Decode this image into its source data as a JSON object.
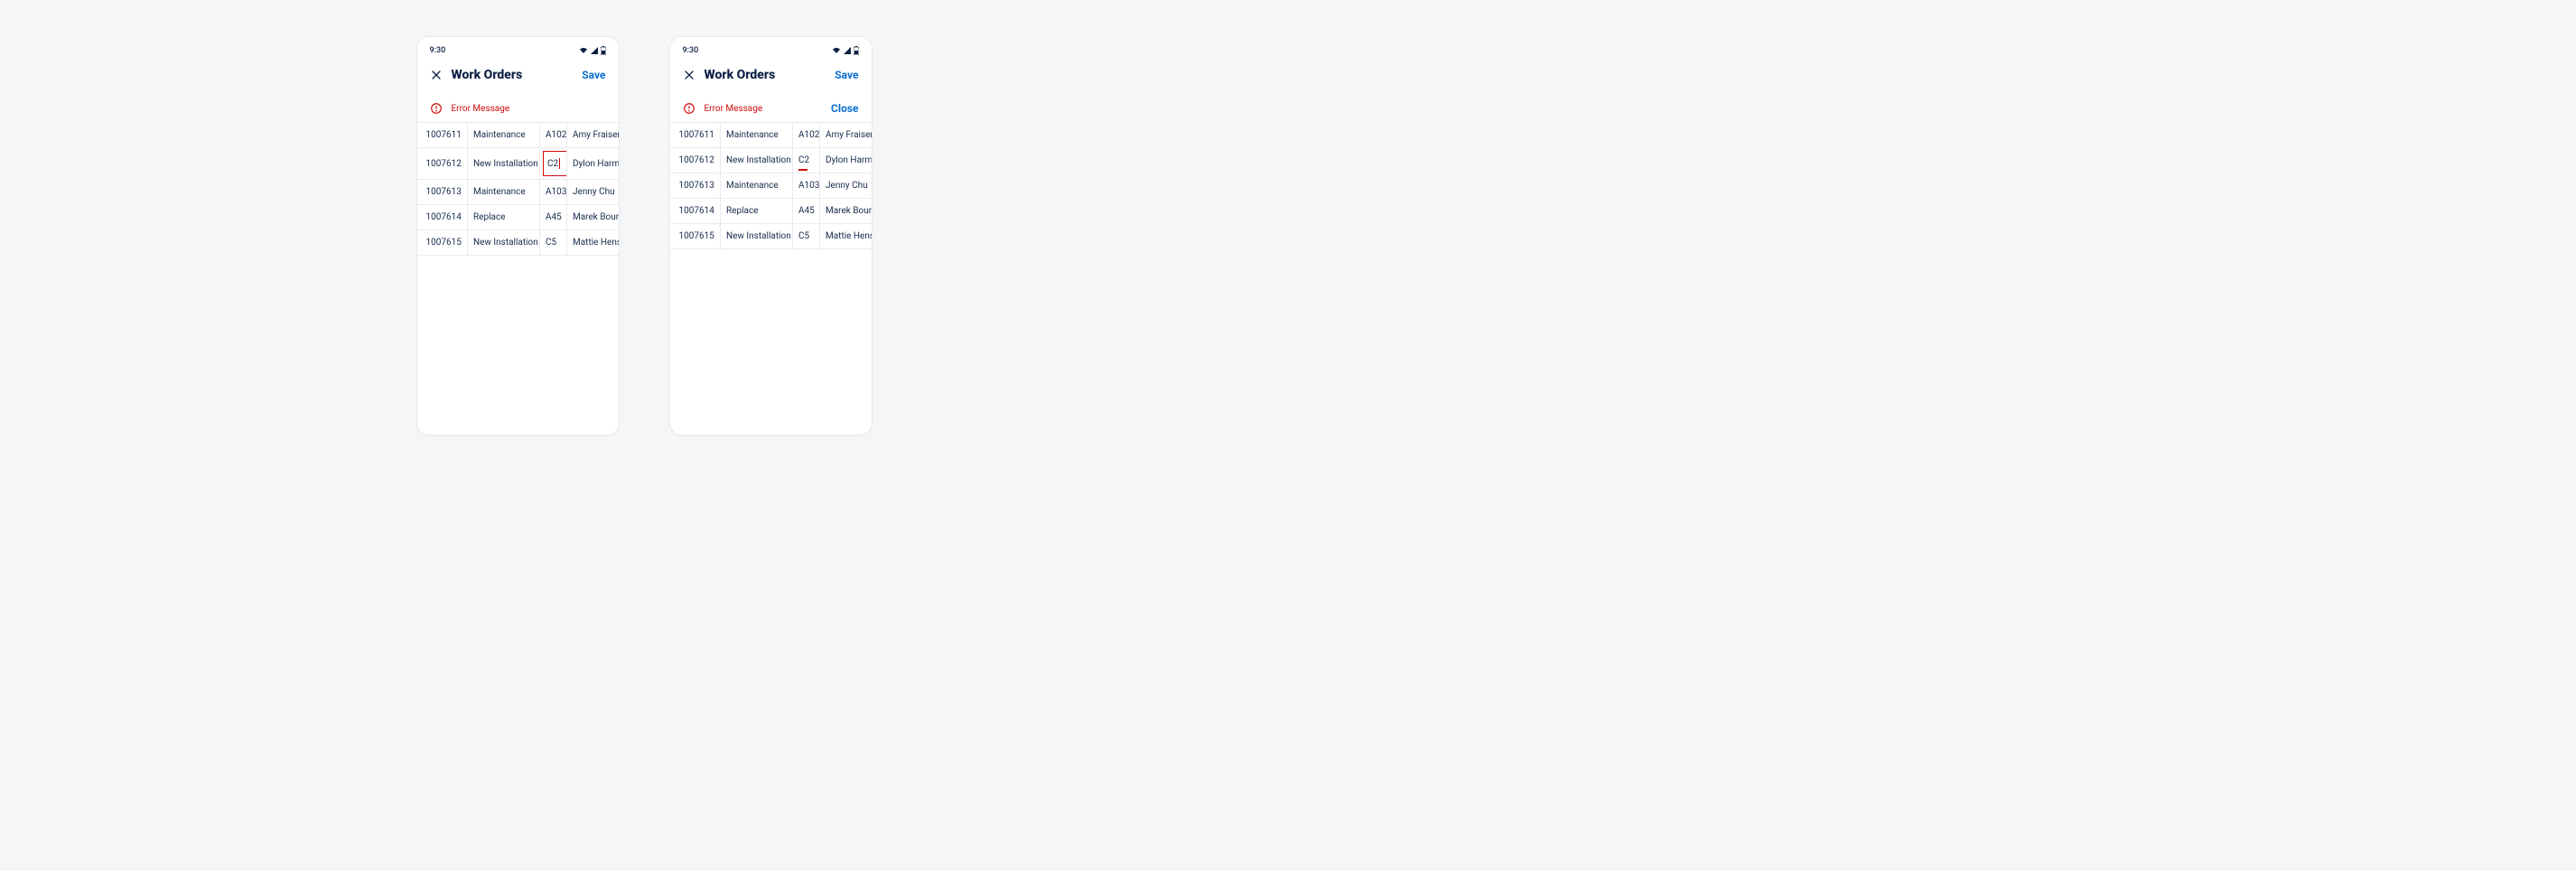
{
  "status": {
    "time": "9:30"
  },
  "header": {
    "title": "Work Orders",
    "save_label": "Save"
  },
  "error": {
    "message": "Error Message",
    "close_label": "Close"
  },
  "rows": [
    {
      "id": "1007611",
      "type": "Maintenance",
      "loc": "A102",
      "name": "Amy Fraiser"
    },
    {
      "id": "1007612",
      "type": "New Installation",
      "loc": "C2",
      "name": "Dylon Harmon"
    },
    {
      "id": "1007613",
      "type": "Maintenance",
      "loc": "A103",
      "name": "Jenny Chu"
    },
    {
      "id": "1007614",
      "type": "Replace",
      "loc": "A45",
      "name": "Marek Bourne"
    },
    {
      "id": "1007615",
      "type": "New Installation",
      "loc": "C5",
      "name": "Mattie Henson"
    }
  ],
  "colors": {
    "error": "#d20a0a",
    "link": "#0a6ed1",
    "text": "#0a1f44"
  }
}
